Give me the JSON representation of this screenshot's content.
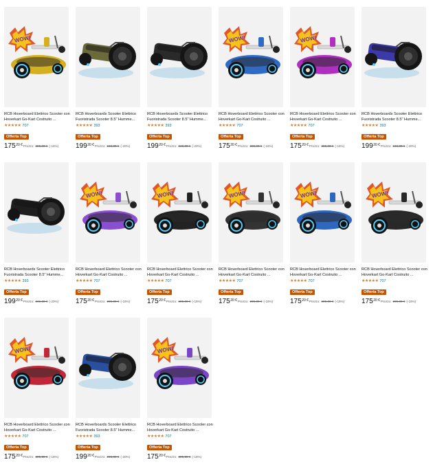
{
  "colors": {
    "badge": "#c45500",
    "star": "#de7921",
    "link": "#007185"
  },
  "products": [
    {
      "title": "RCB Hoverboard Elettrico Scooter con Hoverkart Go-Kart Costruito ...",
      "reviews": "707",
      "badge": "Offerta Top",
      "price_int": "175",
      "price_frac": "20 €",
      "price_label": "Prezzo:",
      "old_price": "289,00 €",
      "discount": "(-16%)",
      "variant": "kart",
      "color": "#d4b020"
    },
    {
      "title": "RCB Hoverboards Scooter Elettrico Fuoristrada Scooter 8.5\" Humme...",
      "reviews": "393",
      "badge": "Offerta Top",
      "price_int": "199",
      "price_frac": "20 €",
      "price_label": "Prezzo:",
      "old_price": "249,00 €",
      "discount": "(-20%)",
      "variant": "offroad",
      "color": "#6b6a3a"
    },
    {
      "title": "RCB Hoverboards Scooter Elettrico Fuoristrada Scooter 8.5\" Humme...",
      "reviews": "393",
      "badge": "Offerta Top",
      "price_int": "199",
      "price_frac": "20 €",
      "price_label": "Prezzo:",
      "old_price": "249,00 €",
      "discount": "(-20%)",
      "variant": "offroad",
      "color": "#2a2a2a"
    },
    {
      "title": "RCB Hoverboard Elettrico Scooter con Hoverkart Go-Kart Costruito ...",
      "reviews": "707",
      "badge": "Offerta Top",
      "price_int": "175",
      "price_frac": "20 €",
      "price_label": "Prezzo:",
      "old_price": "209,00 €",
      "discount": "(-16%)",
      "variant": "kart",
      "color": "#2f6bc4"
    },
    {
      "title": "RCB Hoverboard Elettrico Scooter con Hoverkart Go-Kart Costruito ...",
      "reviews": "707",
      "badge": "Offerta Top",
      "price_int": "175",
      "price_frac": "20 €",
      "price_label": "Prezzo:",
      "old_price": "209,00 €",
      "discount": "(-16%)",
      "variant": "kart",
      "color": "#b02ec0"
    },
    {
      "title": "RCB Hoverboards Scooter Elettrico Fuoristrada Scooter 8.5\" Humme...",
      "reviews": "393",
      "badge": "Offerta Top",
      "price_int": "199",
      "price_frac": "20 €",
      "price_label": "Prezzo:",
      "old_price": "249,00 €",
      "discount": "(-20%)",
      "variant": "offroad",
      "color": "#3b3aa8"
    },
    {
      "title": "RCB Hoverboards Scooter Elettrico Fuoristrada Scooter 8.5\" Humme...",
      "reviews": "393",
      "badge": "Offerta Top",
      "price_int": "199",
      "price_frac": "20 €",
      "price_label": "Prezzo:",
      "old_price": "249,00 €",
      "discount": "(-20%)",
      "variant": "offroad",
      "color": "#1e1e1e"
    },
    {
      "title": "RCB Hoverboard Elettrico Scooter con Hoverkart Go-Kart Costruito ...",
      "reviews": "707",
      "badge": "Offerta Top",
      "price_int": "175",
      "price_frac": "20 €",
      "price_label": "Prezzo:",
      "old_price": "209,00 €",
      "discount": "(-16%)",
      "variant": "kart",
      "color": "#8a4fd0"
    },
    {
      "title": "RCB Hoverboard Elettrico Scooter con Hoverkart Go-Kart Costruito ...",
      "reviews": "707",
      "badge": "Offerta Top",
      "price_int": "175",
      "price_frac": "20 €",
      "price_label": "Prezzo:",
      "old_price": "209,00 €",
      "discount": "(-16%)",
      "variant": "kart",
      "color": "#222222"
    },
    {
      "title": "RCB Hoverboard Elettrico Scooter con Hoverkart Go-Kart Costruito ...",
      "reviews": "707",
      "badge": "Offerta Top",
      "price_int": "175",
      "price_frac": "20 €",
      "price_label": "Prezzo:",
      "old_price": "209,00 €",
      "discount": "(-16%)",
      "variant": "kart",
      "color": "#333333"
    },
    {
      "title": "RCB Hoverboard Elettrico Scooter con Hoverkart Go-Kart Costruito ...",
      "reviews": "707",
      "badge": "Offerta Top",
      "price_int": "175",
      "price_frac": "20 €",
      "price_label": "Prezzo:",
      "old_price": "209,00 €",
      "discount": "(-16%)",
      "variant": "kart",
      "color": "#2e67c0"
    },
    {
      "title": "RCB Hoverboard Elettrico Scooter con Hoverkart Go-Kart Costruito ...",
      "reviews": "707",
      "badge": "Offerta Top",
      "price_int": "175",
      "price_frac": "20 €",
      "price_label": "Prezzo:",
      "old_price": "209,00 €",
      "discount": "(-16%)",
      "variant": "kart",
      "color": "#282828"
    },
    {
      "title": "RCB Hoverboard Elettrico Scooter con Hoverkart Go-Kart Costruito ...",
      "reviews": "707",
      "badge": "Offerta Top",
      "price_int": "175",
      "price_frac": "20 €",
      "price_label": "Prezzo:",
      "old_price": "209,00 €",
      "discount": "(-16%)",
      "variant": "kart",
      "color": "#c0283a"
    },
    {
      "title": "RCB Hoverboards Scooter Elettrico Fuoristrada Scooter 8.5\" Humme...",
      "reviews": "393",
      "badge": "Offerta Top",
      "price_int": "199",
      "price_frac": "20 €",
      "price_label": "Prezzo:",
      "old_price": "249,00 €",
      "discount": "(-20%)",
      "variant": "offroad",
      "color": "#2b4fa0"
    },
    {
      "title": "RCB Hoverboard Elettrico Scooter con Hoverkart Go-Kart Costruito ...",
      "reviews": "707",
      "badge": "Offerta Top",
      "price_int": "175",
      "price_frac": "20 €",
      "price_label": "Prezzo:",
      "old_price": "209,00 €",
      "discount": "(-16%)",
      "variant": "kart",
      "color": "#7a45c8"
    }
  ]
}
